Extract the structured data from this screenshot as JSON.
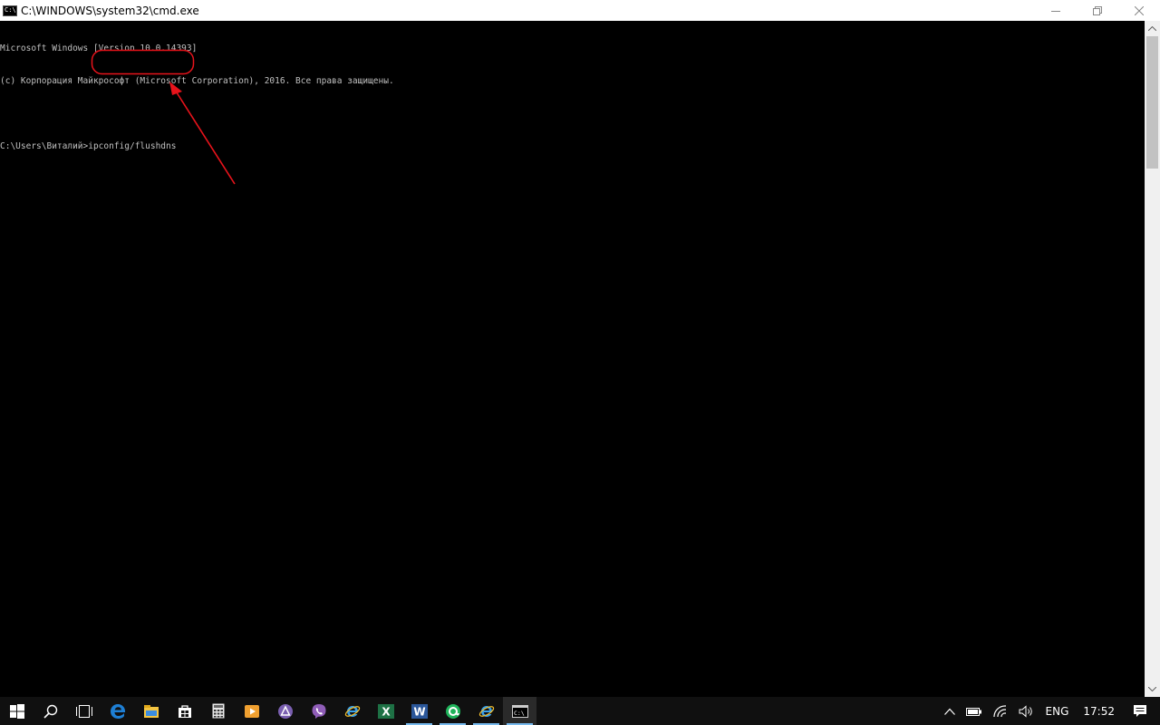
{
  "window": {
    "title": "C:\\WINDOWS\\system32\\cmd.exe",
    "icon_label": "C:\\"
  },
  "console": {
    "lines": [
      "Microsoft Windows [Version 10.0.14393]",
      "(c) Корпорация Майкрософт (Microsoft Corporation), 2016. Все права защищены.",
      "",
      "C:\\Users\\Виталий>ipconfig/flushdns"
    ],
    "prompt": "C:\\Users\\Виталий>",
    "command": "ipconfig/flushdns"
  },
  "annotation": {
    "highlight_color": "#e8131b"
  },
  "taskbar": {
    "items": [
      {
        "icon": "windows-start-icon",
        "active": false
      },
      {
        "icon": "search-icon",
        "active": false
      },
      {
        "icon": "task-view-icon",
        "active": false
      },
      {
        "icon": "edge-icon",
        "active": false
      },
      {
        "icon": "file-explorer-icon",
        "active": false
      },
      {
        "icon": "store-icon",
        "active": false
      },
      {
        "icon": "calculator-icon",
        "active": false
      },
      {
        "icon": "media-player-icon",
        "active": false
      },
      {
        "icon": "app-purple-icon",
        "active": false
      },
      {
        "icon": "viber-icon",
        "active": false
      },
      {
        "icon": "internet-explorer-icon",
        "active": false
      },
      {
        "icon": "excel-icon",
        "active": false
      },
      {
        "icon": "word-icon",
        "active": true
      },
      {
        "icon": "app-green-icon",
        "active": true
      },
      {
        "icon": "internet-explorer-icon-2",
        "active": true
      },
      {
        "icon": "cmd-icon",
        "active": true,
        "current": true
      }
    ],
    "tray": {
      "language": "ENG",
      "time": "17:52"
    }
  },
  "colors": {
    "console_text": "#c0c0c0",
    "console_bg": "#000000",
    "taskbar_bg": "#101010",
    "accent": "#76b9ed"
  }
}
